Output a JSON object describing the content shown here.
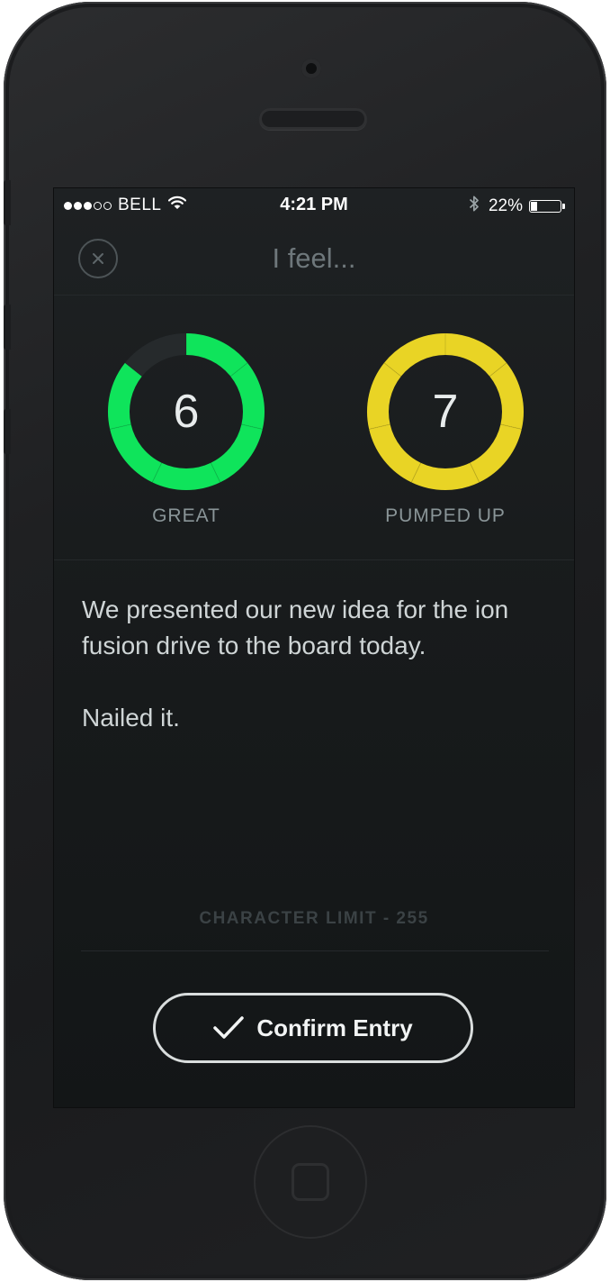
{
  "status_bar": {
    "carrier": "BELL",
    "time": "4:21 PM",
    "battery_percent": "22%",
    "battery_level": 0.22,
    "signal_bars_filled": 3,
    "signal_bars_total": 5
  },
  "header": {
    "title": "I feel...",
    "close_icon": "close-icon"
  },
  "moods": [
    {
      "value": "6",
      "label": "GREAT",
      "level": 6,
      "max": 7,
      "color": "#0fe45b"
    },
    {
      "value": "7",
      "label": "PUMPED UP",
      "level": 7,
      "max": 7,
      "color": "#e9d425"
    }
  ],
  "entry": {
    "paragraphs": [
      "We presented our new idea for the ion fusion drive to the board today.",
      "Nailed it."
    ]
  },
  "character_limit": "CHARACTER LIMIT - 255",
  "confirm": {
    "label": "Confirm Entry",
    "icon": "checkmark-icon"
  },
  "colors": {
    "screen_background": "#181b1c",
    "ring_track": "#262a2c"
  }
}
